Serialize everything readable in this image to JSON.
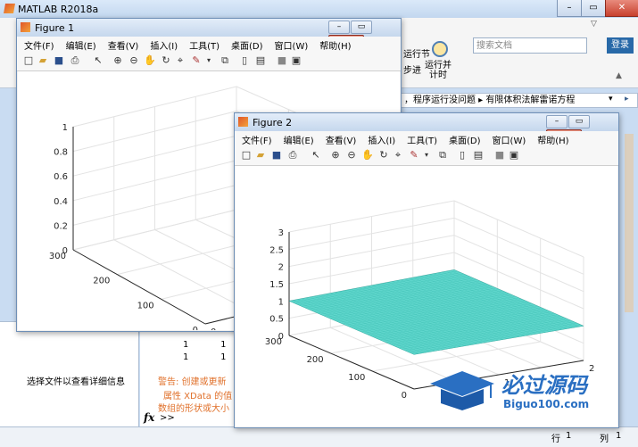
{
  "main_window": {
    "title": "MATLAB R2018a",
    "search_placeholder": "搜索文档",
    "login_label": "登录",
    "toolstrip": {
      "run_section_label": "运行节",
      "advance_label": "步进",
      "run_and_time_label": "运行并\n计时"
    },
    "address_path": "，程序运行没问题 ▸ 有限体积法解雷诺方程",
    "left_panel_message": "选择文件以查看详细信息",
    "command_window": {
      "matrix_rows": [
        [
          "1",
          "1"
        ],
        [
          "1",
          "1"
        ]
      ],
      "warning_lines": [
        "警告: 创建或更新",
        "属性  XData 的值",
        "数组的形状或大小"
      ],
      "prompt": ">>"
    },
    "status": {
      "row_label": "行",
      "row_value": "1",
      "col_label": "列",
      "col_value": "1"
    }
  },
  "figure1": {
    "title": "Figure 1",
    "menu": [
      "文件(F)",
      "编辑(E)",
      "查看(V)",
      "插入(I)",
      "工具(T)",
      "桌面(D)",
      "窗口(W)",
      "帮助(H)"
    ],
    "chart_data": {
      "type": "surface3d",
      "z_ticks": [
        "0",
        "0.2",
        "0.4",
        "0.6",
        "0.8",
        "1"
      ],
      "y_ticks": [
        "0",
        "100",
        "200",
        "300"
      ],
      "x_ticks": [
        "0"
      ],
      "zlim": [
        0,
        1
      ],
      "ylim": [
        0,
        300
      ],
      "grid": true
    }
  },
  "figure2": {
    "title": "Figure 2",
    "menu": [
      "文件(F)",
      "编辑(E)",
      "查看(V)",
      "插入(I)",
      "工具(T)",
      "桌面(D)",
      "窗口(W)",
      "帮助(H)"
    ],
    "chart_data": {
      "type": "surface3d",
      "z_ticks": [
        "0",
        "0.5",
        "1",
        "1.5",
        "2",
        "2.5",
        "3"
      ],
      "y_ticks": [
        "0",
        "100",
        "200",
        "300"
      ],
      "x_ticks": [
        "1",
        "2"
      ],
      "zlim": [
        0,
        3
      ],
      "ylim": [
        0,
        300
      ],
      "xlim": [
        0,
        2
      ],
      "surface_z": 1,
      "surface_color": "#5fd6cc",
      "grid": true
    }
  },
  "watermark": {
    "brand": "必过源码",
    "url": "Biguo100.com"
  }
}
